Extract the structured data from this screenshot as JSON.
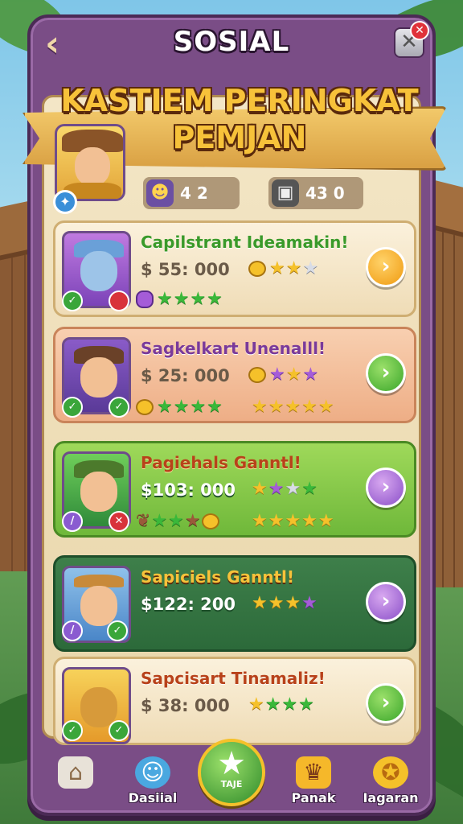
{
  "header": {
    "title": "SOSIAL",
    "back_icon": "chevron-left-icon",
    "close_icon": "close-icon"
  },
  "banner": {
    "line1": "KASTIEM PERINGKAT",
    "line2": "PEMJAN"
  },
  "player": {
    "stat_1": "4 2",
    "stat_2": "43 0"
  },
  "leaderboard": [
    {
      "title": "Capilstrant Ideamakin!",
      "amount": "$ 55: 000",
      "button_color": "orange"
    },
    {
      "title": "Sagkelkart Unenalll!",
      "amount": "$ 25: 000",
      "button_color": "green"
    },
    {
      "title": "Pagiehals Ganntl!",
      "amount": "$103: 000",
      "button_color": "purple"
    },
    {
      "title": "Sapiciels Ganntl!",
      "amount": "$122: 200",
      "button_color": "purple"
    },
    {
      "title": "Sapcisart Tinamaliz!",
      "amount": "$ 38: 000",
      "button_color": "green"
    }
  ],
  "nav": {
    "home_label": "",
    "social_label": "Dasiial",
    "center_label": "TAJE",
    "rank_label": "Panak",
    "reward_label": "Iagaran"
  },
  "colors": {
    "frame": "#7a4d86",
    "parchment": "#f3e6c6",
    "banner_gold": "#f7c23a"
  }
}
